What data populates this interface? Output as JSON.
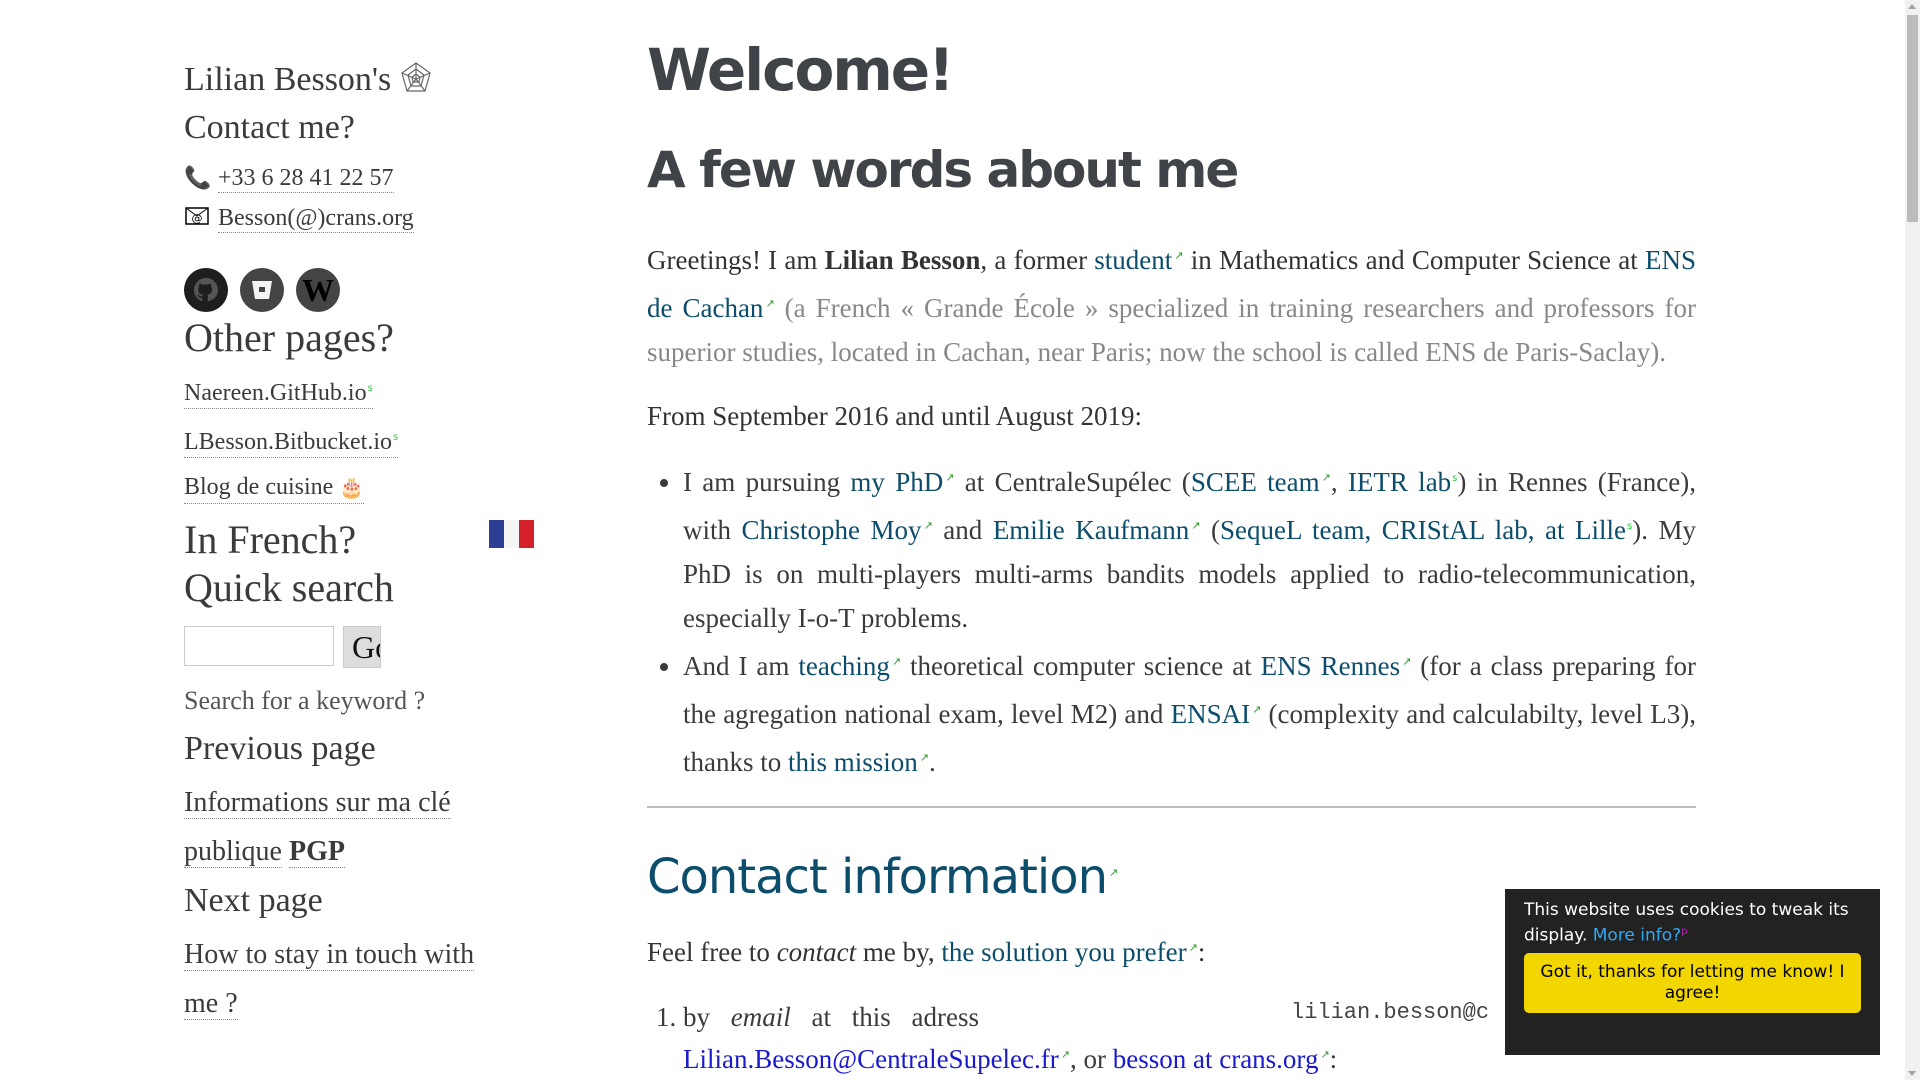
{
  "sidebar": {
    "site_title": "Lilian Besson's",
    "site_icon": "spiderweb-icon",
    "contact_heading": "Contact me?",
    "phone_icon": "phone-icon",
    "phone": "+33 6 28 41 22 57",
    "email_icon": "envelope-at-icon",
    "email": "Besson(@)crans.org",
    "socials": [
      {
        "name": "github-icon"
      },
      {
        "name": "bitbucket-icon"
      },
      {
        "name": "wikipedia-icon"
      }
    ],
    "other_pages_heading": "Other pages?",
    "pages": [
      {
        "label": "Naereen.GitHub.io",
        "mark": "s"
      },
      {
        "label": "LBesson.Bitbucket.io",
        "mark": "s"
      },
      {
        "label": "Blog de cuisine",
        "icon": "cake-icon"
      }
    ],
    "french_heading": "In French?",
    "search_heading": "Quick search",
    "search_value": "",
    "go_label": "Go",
    "search_hint": "Search for a keyword ?",
    "prev_heading": "Previous page",
    "prev_link": "Informations sur ma clé publique",
    "prev_link_bold": "PGP",
    "next_heading": "Next page",
    "next_link": "How to stay in touch with me ?"
  },
  "main": {
    "title": "Welcome!",
    "about_heading": "A few words about me",
    "intro": {
      "t1": "Greetings! I am ",
      "name": "Lilian Besson",
      "t2": ", a former ",
      "student_link": "student",
      "t3": " in Mathematics and Computer Science at ",
      "ens_link": "ENS de Cachan",
      "muted": " (a French « Grande École » specialized in training researchers and professors for superior studies, located in Cachan, near Paris; now the school is called ENS de Paris-Saclay)."
    },
    "period": "From September 2016 and until August 2019:",
    "bullet1": {
      "t1": "I am pursuing ",
      "phd_link": "my PhD",
      "t2": " at CentraleSupélec (",
      "scee_link": "SCEE team",
      "t3": ", ",
      "ietr_link": "IETR lab",
      "t4": ") in Rennes (France), with ",
      "moy_link": "Christophe Moy",
      "t5": " and ",
      "kaufmann_link": "Emilie Kaufmann",
      "t6": " (",
      "sequel_link": "SequeL team, CRIStAL lab, at Lille",
      "t7": "). My PhD is on multi-players multi-arms bandits models applied to radio-telecommunication, especially I-o-T problems."
    },
    "bullet2": {
      "t1": "And I am ",
      "teaching_link": "teaching",
      "t2": " theoretical computer science at ",
      "rennes_link": "ENS Rennes",
      "t3": " (for a class preparing for the agregation national exam, level M2) and ",
      "ensai_link": "ENSAI",
      "t4": " (complexity and calculabilty, level L3), thanks to ",
      "mission_link": "this mission",
      "t5": "."
    },
    "contact_heading": "Contact information",
    "contact_intro": {
      "t1": "Feel free to ",
      "em": "contact",
      "t2": " me by, ",
      "link": "the solution you prefer",
      "t3": ":"
    },
    "contact_item1": {
      "t1": "by ",
      "em": "email",
      "t2": " at this adress",
      "link1": "Lilian.Besson@CentraleSupelec.fr",
      "t3": ", or ",
      "link2": "besson at crans.org",
      "t4": ":"
    },
    "mono_email": "lilian.besson@c"
  },
  "cookie": {
    "message": "This website uses cookies to tweak its display.",
    "more_link": "More info?",
    "more_sup": "p",
    "accept_label": "Got it, thanks for letting me know! I agree!"
  },
  "colors": {
    "link": "#0b4d6b",
    "cookie_bg": "#222222",
    "cookie_button": "#f1d600",
    "external_mark": "#2aa02a"
  }
}
